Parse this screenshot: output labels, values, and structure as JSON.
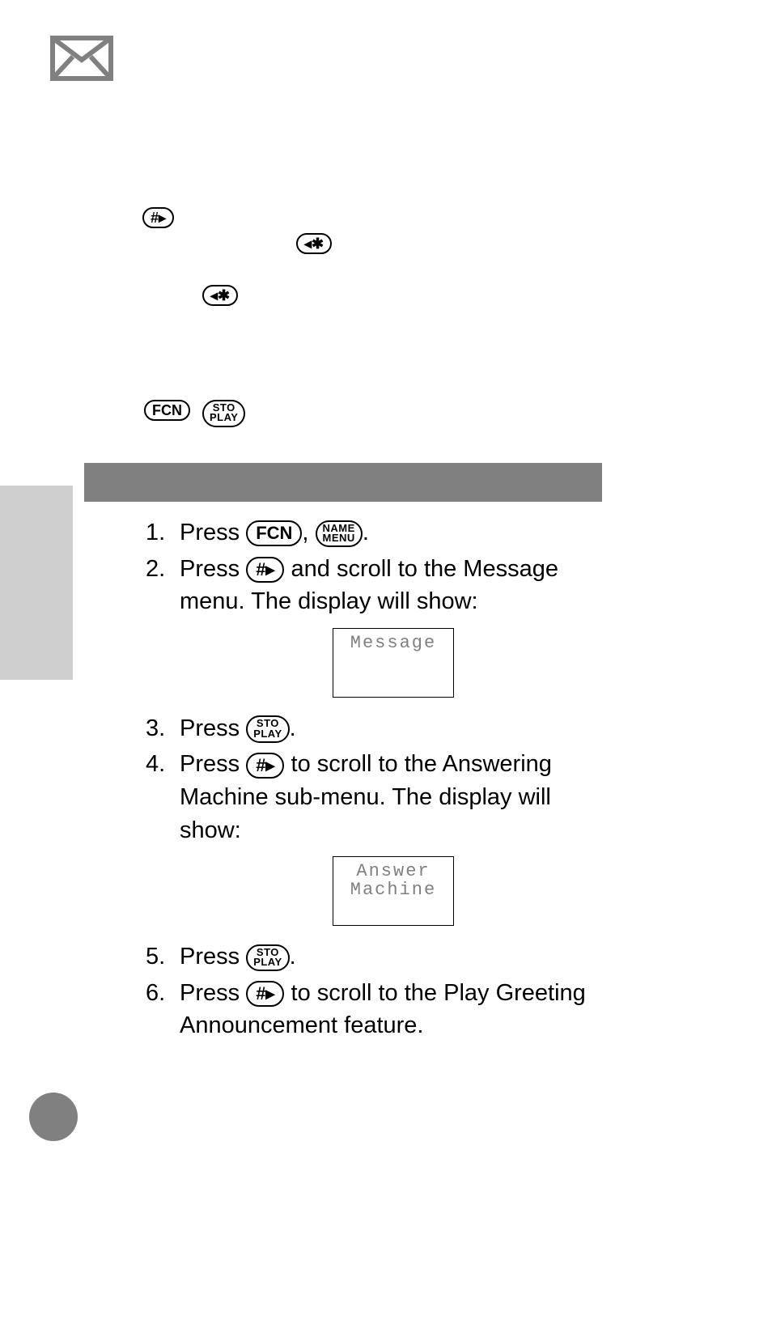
{
  "icons": {
    "envelope": "envelope-icon"
  },
  "floatingButtons": {
    "b1": "#▸",
    "b2": "◂✱",
    "b3": "◂✱",
    "b4": "FCN",
    "b5_top": "STO",
    "b5_bot": "PLAY"
  },
  "buttons": {
    "fcn": "FCN",
    "name_top": "NAME",
    "name_bot": "MENU",
    "sto_top": "STO",
    "sto_bot": "PLAY",
    "hash": "#▸",
    "star": "◂✱"
  },
  "steps": {
    "s1": {
      "n": "1.",
      "a": "Press ",
      "b": ", ",
      "c": "."
    },
    "s2": {
      "n": "2.",
      "a": "Press ",
      "b": " and scroll to the Message menu. The display will show:"
    },
    "lcd1": {
      "l1": "Message",
      "l2": ""
    },
    "s3": {
      "n": "3.",
      "a": "Press ",
      "b": "."
    },
    "s4": {
      "n": "4.",
      "a": "Press ",
      "b": " to scroll to the Answering Machine sub-menu. The display will show:"
    },
    "lcd2": {
      "l1": "Answer",
      "l2": "Machine"
    },
    "s5": {
      "n": "5.",
      "a": "Press ",
      "b": "."
    },
    "s6": {
      "n": "6.",
      "a": "Press ",
      "b": " to scroll to the Play Greeting Announcement feature."
    }
  }
}
